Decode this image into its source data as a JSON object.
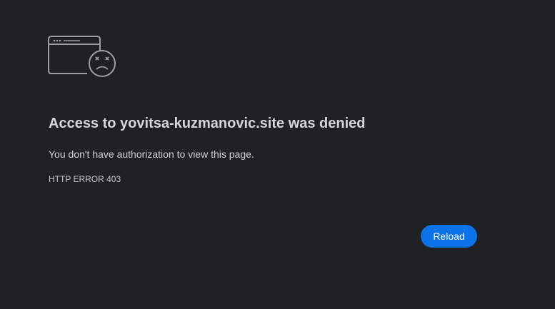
{
  "page": {
    "title_text": "Access to yovitsa-kuzmanovic.site was denied",
    "message": "You don't have authorization to view this page.",
    "error_code": "HTTP ERROR 403"
  },
  "actions": {
    "reload_label": "Reload"
  },
  "icon": {
    "name": "sad-browser-window-icon"
  },
  "colors": {
    "background": "#202124",
    "text": "#c9cbce",
    "accent": "#0b72e7",
    "icon_stroke": "#9aa0a6"
  }
}
